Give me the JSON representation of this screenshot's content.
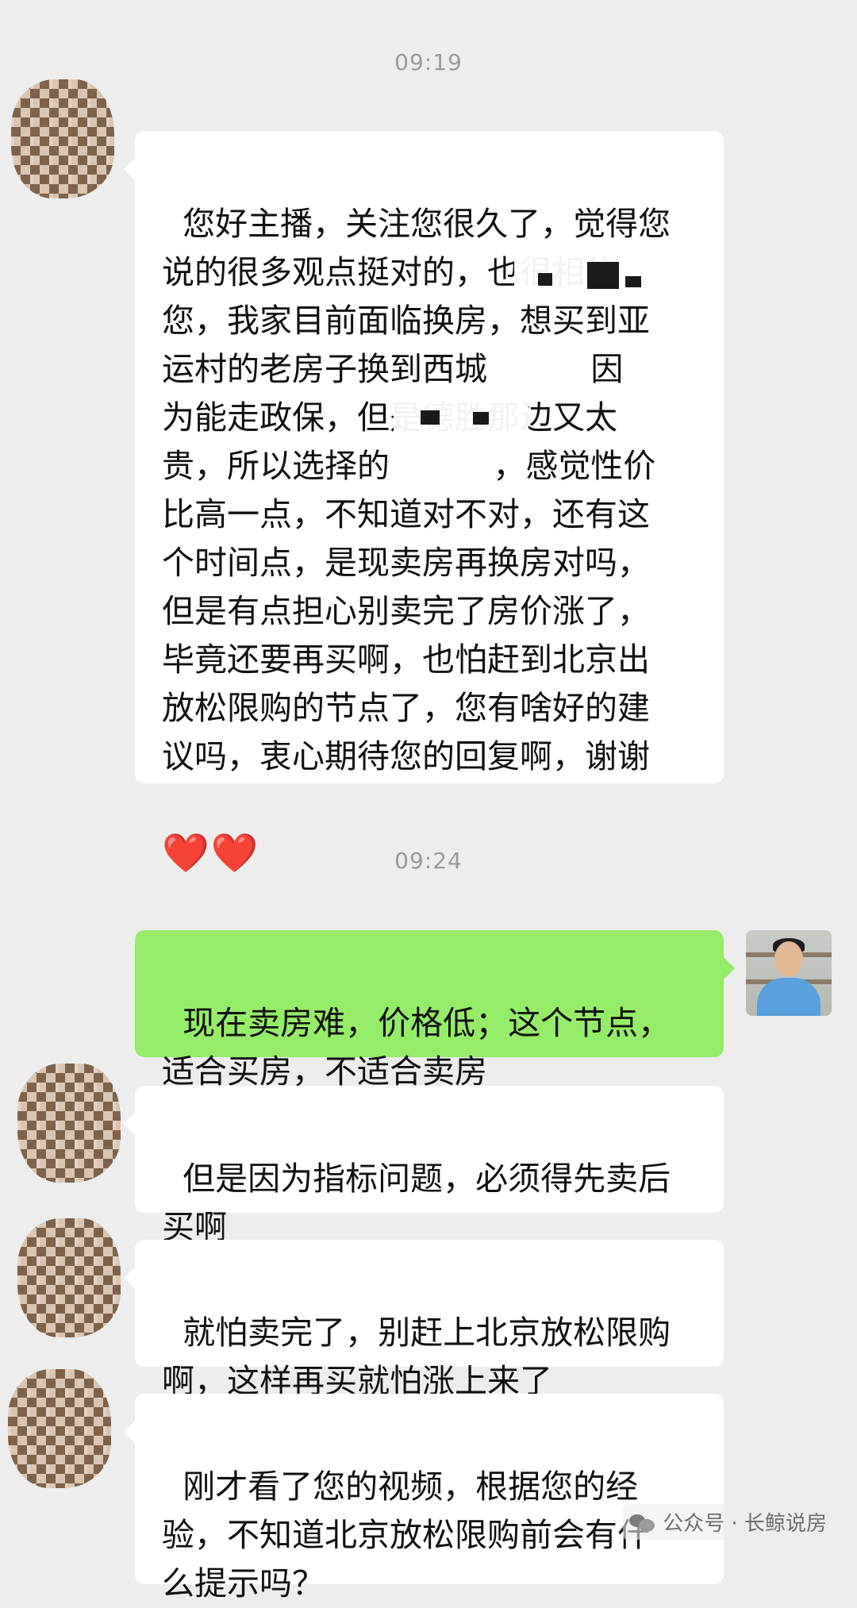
{
  "chat": {
    "timestamps": [
      "09:19",
      "09:24"
    ],
    "messages": [
      {
        "side": "received",
        "text": "您好主播，关注您很久了，觉得您\n说的很多观点挺对的，也很相信\n您，我家目前面临换房，想买到亚\n运村的老房子换到西城          因\n为能走政保，但是德胜那边又太\n贵，所以选择的          ，感觉性价\n比高一点，不知道对不对，还有这\n个时间点，是现卖房再换房对吗，\n但是有点担心别卖完了房价涨了，\n毕竟还要再买啊，也怕赶到北京出\n放松限购的节点了，您有啥好的建\n议吗，衷心期待您的回复啊，谢谢",
        "emoji": "❤️❤️"
      },
      {
        "side": "sent",
        "text": "现在卖房难，价格低；这个节点，\n适合买房，不适合卖房"
      },
      {
        "side": "received",
        "text": "但是因为指标问题，必须得先卖后\n买啊"
      },
      {
        "side": "received",
        "text": "就怕卖完了，别赶上北京放松限购\n啊，这样再买就怕涨上来了"
      },
      {
        "side": "received",
        "text": "刚才看了您的视频，根据您的经\n验，不知道北京放松限购前会有什\n么提示吗？"
      }
    ]
  },
  "watermark": {
    "icon": "wechat-icon",
    "text": "公众号 · 长鲸说房"
  },
  "colors": {
    "background": "#ededed",
    "received_bubble": "#ffffff",
    "sent_bubble": "#95ec69",
    "timestamp": "#9a9a9a"
  }
}
